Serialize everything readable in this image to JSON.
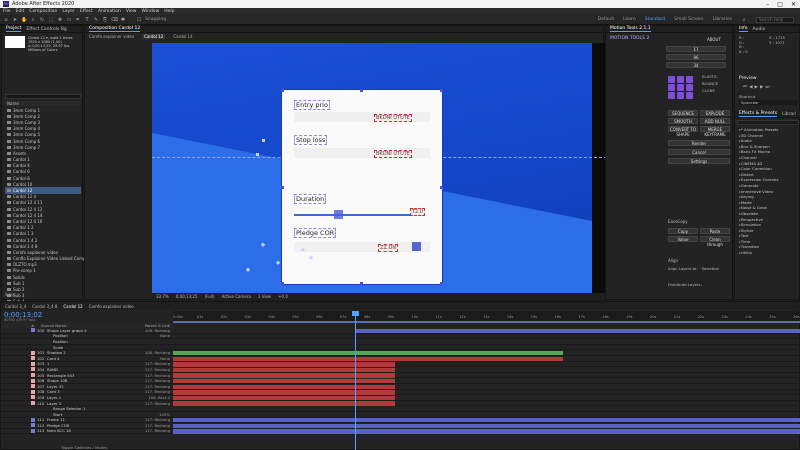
{
  "titlebar": {
    "title": "Adobe After Effects 2020",
    "app_icon": "Ae",
    "controls": [
      "–",
      "□",
      "✕"
    ]
  },
  "menubar": {
    "items": [
      "File",
      "Edit",
      "Composition",
      "Layer",
      "Effect",
      "Animation",
      "View",
      "Window",
      "Help"
    ]
  },
  "toolbar": {
    "snapping_label": "Snapping",
    "workspaces": [
      {
        "label": "Default",
        "active": false
      },
      {
        "label": "Learn",
        "active": false
      },
      {
        "label": "Standard",
        "active": true
      },
      {
        "label": "Small Screen",
        "active": false
      },
      {
        "label": "Libraries",
        "active": false
      }
    ],
    "search_placeholder": "Search Help"
  },
  "project": {
    "tab": "Project",
    "tab2": "Effect Controls Bg",
    "info_lines": [
      "Cardol 12 ▾, used 1 times",
      "1920 x 1080 (1.00)",
      "Δ 0;00;13;25, 29.97 fps",
      "Millions of Colors"
    ],
    "name_header": "Name",
    "search_placeholder": "",
    "items": [
      "3mm Comp 1",
      "3mm Comp 2",
      "3mm Comp 3",
      "3mm Comp 4",
      "3mm Comp 5",
      "3mm Comp 6",
      "3mm Comp 7",
      "Assets",
      "Cardol 1",
      "Cardol 4",
      "Cardol 6",
      "Cardol 8",
      "Cardol 10",
      "Cardol 12",
      "Cardol 12 4",
      "Cardol 12 4 11",
      "Cardol 12 4 12",
      "Cardol 12 4 14",
      "Cardol 12 4 16",
      "Cardol 1 2",
      "Cardol 1 3",
      "Cardol 1 4 2",
      "Cardol 1 4 8",
      "Comfo explainer video",
      "Conflo Explainer Video Linked Comp 1",
      "DLZTO.mp3",
      "Pre-comp 1",
      "Solids",
      "Sub 1",
      "Sub 2",
      "Sub 3",
      "Sub 4",
      "Sub 5",
      "Sub 6",
      "tab to frame",
      "Tab graph"
    ],
    "selected_index": 13,
    "footer": "8 bpc"
  },
  "composition": {
    "tab": "Composition Cardol 12",
    "tabs_sub": [
      "Comfo explainer video",
      "Cardol 12",
      "Cardol 14"
    ],
    "card": {
      "row1_label": "Entry prio",
      "row2_label": "Stop loss",
      "row3_label": "Duration",
      "row4_label": "Pledge COR",
      "tag_a": "BKDNI UTUTE",
      "tag_b": "BKDNI UTUTE",
      "tag_c": "ZZ.ON",
      "tag_d": "T2.0"
    },
    "viewer_bar": [
      "33.7%",
      "0;00;13;25",
      "(Full)",
      "Active Camera",
      "1 View",
      "+0.0"
    ]
  },
  "tools_panel": {
    "title": "Motion Tools 2.1.1",
    "brand": "MOTION TOOLS 2",
    "values": [
      "17",
      "96",
      "34"
    ],
    "buttons": [
      "ELASTIC",
      "BOUNCE",
      "CLONE",
      "SEQUENCE",
      "EXPLODE",
      "SMOOTH",
      "ADD NULL",
      "CONVERT TO SHAPE",
      "MERGE KEYFRAME"
    ],
    "about": "ABOUT",
    "effects": [
      "Render",
      "Cancel",
      "Settings"
    ],
    "easecopy_title": "EaseCopy",
    "easecopy_buttons": [
      "Copy",
      "Paste",
      "Value",
      "Clean through"
    ],
    "align_title": "Align",
    "align_label": "Align Layers to:",
    "align_target": "Selection",
    "distribute_label": "Distribute Layers:"
  },
  "right_col": {
    "info_tabs": [
      "Info",
      "Audio"
    ],
    "info_values": [
      "R :",
      "G :",
      "B :",
      "A : 0",
      "X : 1715",
      "Y : 1071"
    ],
    "preview_tab": "Preview",
    "shortcut_label": "Shortcut",
    "shortcut_value": "Spacebar",
    "effects_tab": "Effects & Presets",
    "library_tab": "Librari",
    "effects_list": [
      "* Animation Presets",
      "3D Channel",
      "Audio",
      "Blur & Sharpen",
      "Boris FX Mocha",
      "Channel",
      "CINEMA 4D",
      "Color Correction",
      "Distort",
      "Expression Controls",
      "Generate",
      "Immersive Video",
      "Keying",
      "Matte",
      "Noise & Grain",
      "Obsolete",
      "Perspective",
      "Simulation",
      "Stylize",
      "Text",
      "Time",
      "Transition",
      "Utility"
    ]
  },
  "timeline": {
    "tabs": [
      "Cardol 3_4",
      "Cardol 3_4 8",
      "Cardol 12",
      "Comfo explainer video"
    ],
    "timecode": "0;00;13;02",
    "timecode_sub": "00392 (29.97 fps)",
    "header": {
      "num": "#",
      "source": "Source Name",
      "parent": "Parent & Link"
    },
    "ruler_ticks": [
      "0:00s",
      "01s",
      "02s",
      "03s",
      "04s",
      "05s",
      "06s",
      "07s",
      "08s",
      "09s",
      "10s",
      "11s",
      "12s",
      "13s",
      "14s",
      "15s",
      "16s",
      "17s",
      "18s",
      "19s",
      "20s",
      "21s",
      "22s",
      "23s",
      "24s",
      "25s",
      "26s"
    ],
    "layers": [
      {
        "num": "100",
        "name": "Shape Layer graph 4",
        "color": "#7a7ad0",
        "parent": "106. Rectang"
      },
      {
        "num": "",
        "name": "Position",
        "color": "",
        "parent": "None"
      },
      {
        "num": "",
        "name": "Position",
        "color": "",
        "parent": ""
      },
      {
        "num": "",
        "name": "Scale",
        "color": "",
        "parent": ""
      },
      {
        "num": "101",
        "name": "Shadow 2",
        "color": "#e4a6a6",
        "parent": "106. Rectang"
      },
      {
        "num": "102",
        "name": "Card 4",
        "color": "#e4a6a6",
        "parent": "None"
      },
      {
        "num": "103",
        "name": "1",
        "color": "#e4a6a6",
        "parent": "117. Rectang"
      },
      {
        "num": "104",
        "name": "RAND",
        "color": "#e4a6a6",
        "parent": "117. Rectang"
      },
      {
        "num": "105",
        "name": "Rectangle 943",
        "color": "#e4a6a6",
        "parent": "117. Rectang"
      },
      {
        "num": "106",
        "name": "Shape 106",
        "color": "#e4a6a6",
        "parent": "117. Rectang"
      },
      {
        "num": "107",
        "name": "Layer 32",
        "color": "#e4a6a6",
        "parent": "117. Rectang"
      },
      {
        "num": "108",
        "name": "Card 3",
        "color": "#e4a6a6",
        "parent": "117. Rectang"
      },
      {
        "num": "109",
        "name": "Layer 1",
        "color": "#e4a6a6",
        "parent": "106. Rect 4"
      },
      {
        "num": "110",
        "name": "Layer 2",
        "color": "#e4a6a6",
        "parent": "117. Rectang"
      },
      {
        "num": "",
        "name": "Range Selector 1",
        "color": "",
        "parent": ""
      },
      {
        "num": "",
        "name": "Start",
        "color": "",
        "parent": "100%"
      },
      {
        "num": "111",
        "name": "Frame 11",
        "color": "#7a7ad0",
        "parent": "117. Rectang"
      },
      {
        "num": "112",
        "name": "Pledge COR",
        "color": "#7a7ad0",
        "parent": "117. Rectang"
      },
      {
        "num": "113",
        "name": "Num KCC 16",
        "color": "#7a7ad0",
        "parent": "117. Rectang"
      }
    ],
    "footer": "Toggle Switches / Modes"
  }
}
